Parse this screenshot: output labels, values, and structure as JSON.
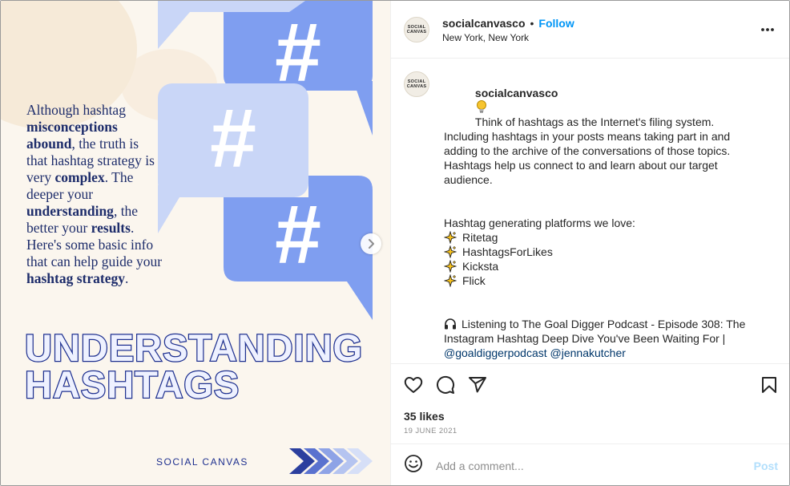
{
  "post_image": {
    "body_segments": [
      {
        "text": "Although hashtag ",
        "bold": false
      },
      {
        "text": "misconceptions abound",
        "bold": true
      },
      {
        "text": ", the truth is that hashtag strategy is  very ",
        "bold": false
      },
      {
        "text": "complex",
        "bold": true
      },
      {
        "text": ". The deeper your ",
        "bold": false
      },
      {
        "text": "understanding",
        "bold": true
      },
      {
        "text": ", the better your ",
        "bold": false
      },
      {
        "text": "results",
        "bold": true
      },
      {
        "text": ". Here's some basic info that can help guide your ",
        "bold": false
      },
      {
        "text": "hashtag strategy",
        "bold": true
      },
      {
        "text": ".",
        "bold": false
      }
    ],
    "headline_line1": "UNDERSTANDING",
    "headline_line2": "HASHTAGS",
    "brand": "SOCIAL CANVAS",
    "colors": {
      "navy": "#1f3190",
      "bubble_light": "#c9d6f7",
      "bubble_dark": "#7f9ef0",
      "background": "#fbf6ee"
    }
  },
  "header": {
    "avatar_text": "SOCIAL CANVAS",
    "username": "socialcanvasco",
    "separator": "•",
    "follow_label": "Follow",
    "location": "New York, New York"
  },
  "caption": {
    "username": "socialcanvasco",
    "intro": "Think of hashtags as the Internet's filing system. Including hashtags in your posts means taking part in and adding to the archive of the conversations of those topics. Hashtags help us connect to and learn about our target audience.",
    "platforms_heading": "Hashtag generating platforms we love:",
    "platforms": [
      "Ritetag",
      "HashtagsForLikes",
      "Kicksta",
      "Flick"
    ],
    "podcast_text": "Listening to The Goal Digger Podcast - Episode 308: The Instagram Hashtag Deep Dive You've Been Waiting For |",
    "mention_1": "@goaldiggerpodcast",
    "mention_2": "@jennakutcher",
    "dots": [
      ".",
      ".",
      "."
    ]
  },
  "actions": {
    "likes": "35 likes",
    "date": "19 JUNE 2021"
  },
  "comment_box": {
    "placeholder": "Add a comment...",
    "post_label": "Post"
  },
  "icons": [
    "lightbulb-icon",
    "sparkles-icon",
    "headphones-icon",
    "heart-icon",
    "comment-icon",
    "share-icon",
    "bookmark-icon",
    "emoji-icon",
    "more-options-icon",
    "chevron-right-icon"
  ]
}
